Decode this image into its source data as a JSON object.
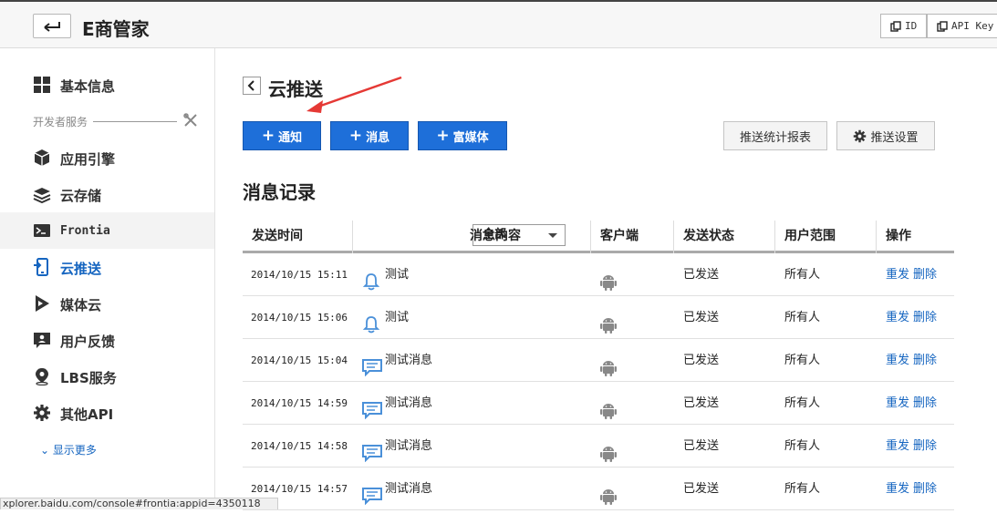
{
  "header": {
    "title": "E商管家",
    "id_label": "ID",
    "apikey_label": "API Key"
  },
  "sidebar": {
    "items": [
      {
        "label": "基本信息",
        "icon": "grid-icon"
      },
      {
        "label": "应用引擎",
        "icon": "cube-icon"
      },
      {
        "label": "云存储",
        "icon": "layers-icon"
      },
      {
        "label": "Frontia",
        "icon": "terminal-icon"
      },
      {
        "label": "云推送",
        "icon": "push-icon"
      },
      {
        "label": "媒体云",
        "icon": "play-icon"
      },
      {
        "label": "用户反馈",
        "icon": "feedback-icon"
      },
      {
        "label": "LBS服务",
        "icon": "location-icon"
      },
      {
        "label": "其他API",
        "icon": "gear-icon"
      }
    ],
    "section_label": "开发者服务",
    "show_more": "显示更多"
  },
  "main": {
    "title": "云推送",
    "buttons": {
      "notify": "通知",
      "message": "消息",
      "rich_media": "富媒体",
      "stats": "推送统计报表",
      "settings": "推送设置"
    },
    "records_title": "消息记录",
    "table": {
      "headers": {
        "time": "发送时间",
        "filter": "全部",
        "content": "消息内容",
        "client": "客户端",
        "status": "发送状态",
        "scope": "用户范围",
        "action": "操作"
      },
      "rows": [
        {
          "time": "2014/10/15 15:11",
          "type": "bell-icon",
          "content": "测试",
          "status": "已发送",
          "scope": "所有人",
          "resend": "重发",
          "delete": "删除"
        },
        {
          "time": "2014/10/15 15:06",
          "type": "bell-icon",
          "content": "测试",
          "status": "已发送",
          "scope": "所有人",
          "resend": "重发",
          "delete": "删除"
        },
        {
          "time": "2014/10/15 15:04",
          "type": "message-icon",
          "content": "测试消息",
          "status": "已发送",
          "scope": "所有人",
          "resend": "重发",
          "delete": "删除"
        },
        {
          "time": "2014/10/15 14:59",
          "type": "message-icon",
          "content": "测试消息",
          "status": "已发送",
          "scope": "所有人",
          "resend": "重发",
          "delete": "删除"
        },
        {
          "time": "2014/10/15 14:58",
          "type": "message-icon",
          "content": "测试消息",
          "status": "已发送",
          "scope": "所有人",
          "resend": "重发",
          "delete": "删除"
        },
        {
          "time": "2014/10/15 14:57",
          "type": "message-icon",
          "content": "测试消息",
          "status": "已发送",
          "scope": "所有人",
          "resend": "重发",
          "delete": "删除"
        }
      ]
    }
  },
  "status_url": "xplorer.baidu.com/console#frontia:appid=4350118",
  "colors": {
    "accent": "#1e6fd9",
    "link": "#1565c0",
    "annotation": "#e53935"
  }
}
